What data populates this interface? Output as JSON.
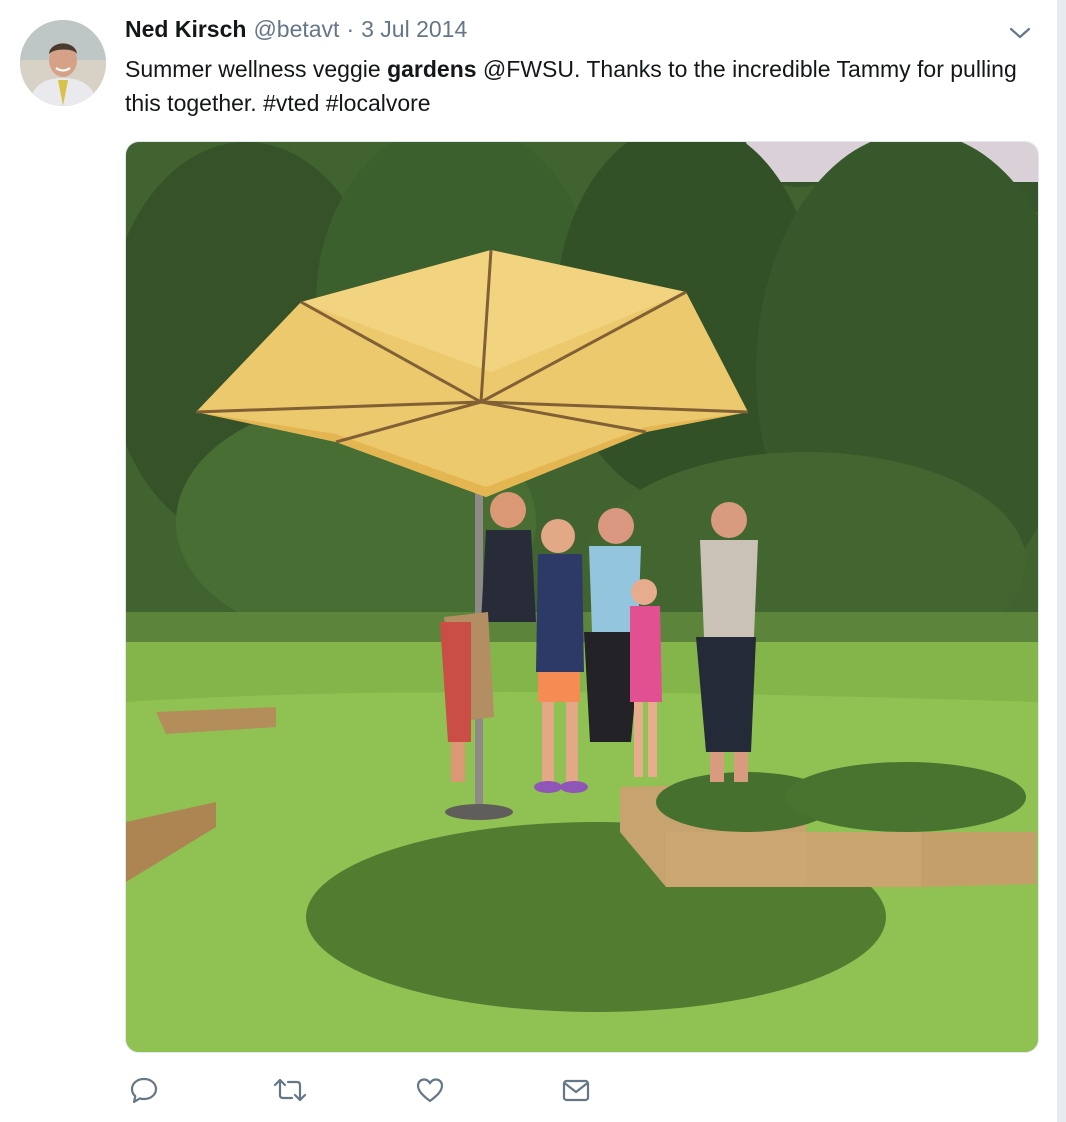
{
  "tweet": {
    "author_name": "Ned Kirsch",
    "author_handle": "@betavt",
    "separator": "·",
    "date": "3 Jul 2014",
    "text_before": "Summer wellness veggie ",
    "text_bold": "gardens",
    "text_after": " @FWSU. Thanks to the incredible Tammy for pulling this together. #vted #localvore"
  },
  "icons": {
    "caret": "chevron-down-icon",
    "reply": "reply-icon",
    "retweet": "retweet-icon",
    "like": "heart-icon",
    "dm": "envelope-icon"
  },
  "colors": {
    "text": "#14171a",
    "secondary": "#657786",
    "icon": "#657786"
  }
}
